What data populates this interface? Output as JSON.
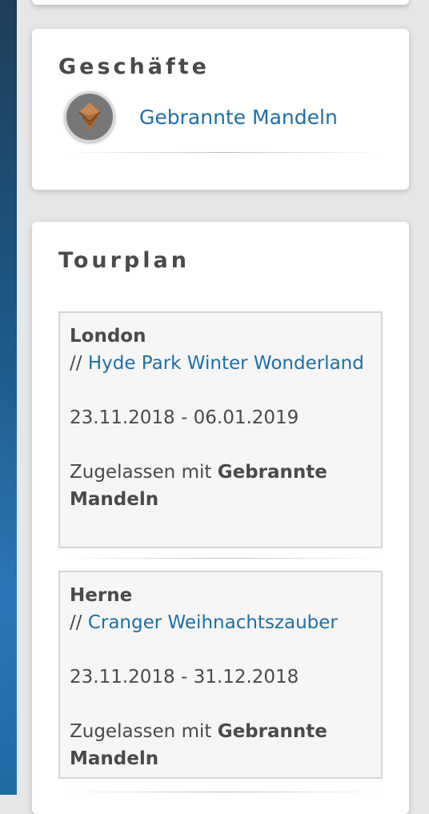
{
  "shops_section": {
    "title": "Geschäfte",
    "shops": [
      {
        "name": "Gebrannte Mandeln",
        "icon": "diamond-logo-icon"
      }
    ]
  },
  "tour_section": {
    "title": "Tourplan",
    "items": [
      {
        "city": "London",
        "prefix": "// ",
        "event": "Hyde Park Winter Wonderland",
        "dates": "23.11.2018 - 06.01.2019",
        "approved_prefix": "Zugelassen mit ",
        "approved_with": "Gebrannte Mandeln"
      },
      {
        "city": "Herne",
        "prefix": "// ",
        "event": "Cranger Weihnachtszauber",
        "dates": "23.11.2018 - 31.12.2018",
        "approved_prefix": "Zugelassen mit ",
        "approved_with": "Gebrannte Mandeln"
      }
    ]
  },
  "colors": {
    "link": "#1f6fa6",
    "text": "#4a4a4a",
    "card_bg": "#ffffff",
    "page_bg": "#e7e7e7",
    "logo_fill": "#a86a3a"
  }
}
